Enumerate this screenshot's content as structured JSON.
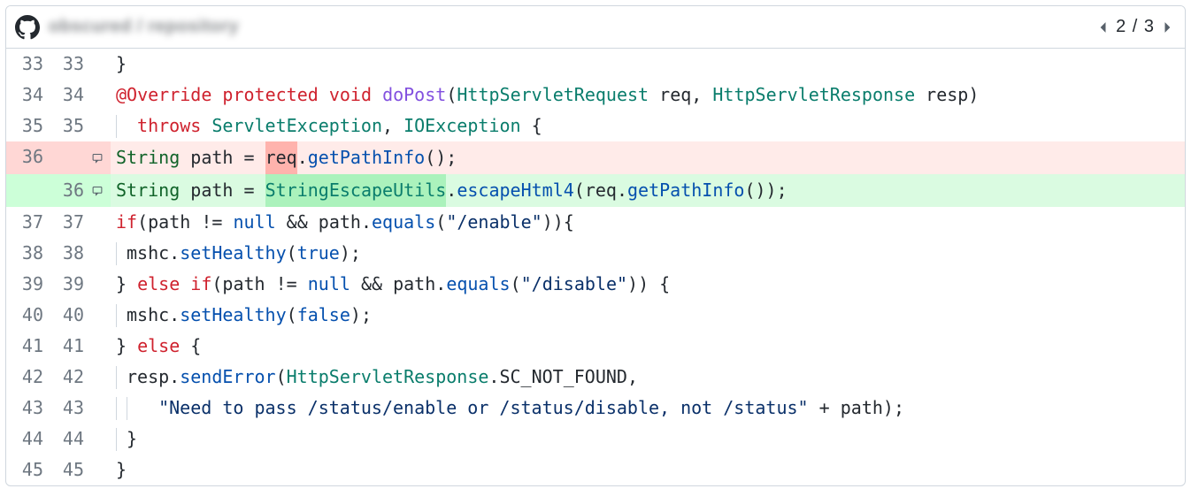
{
  "header": {
    "repo_name_obscured": "obscured / repository",
    "pager": {
      "position": "2 / 3"
    }
  },
  "lines": {
    "l33": {
      "old": "33",
      "new": "33",
      "tokens": [
        {
          "t": "}",
          "c": "c-plain"
        }
      ]
    },
    "l34": {
      "old": "34",
      "new": "34",
      "tokens": [
        {
          "t": "@Override",
          "c": "c-ann"
        },
        {
          "t": " ",
          "c": "c-plain"
        },
        {
          "t": "protected",
          "c": "c-key"
        },
        {
          "t": " ",
          "c": "c-plain"
        },
        {
          "t": "void",
          "c": "c-void"
        },
        {
          "t": " ",
          "c": "c-plain"
        },
        {
          "t": "doPost",
          "c": "c-func"
        },
        {
          "t": "(",
          "c": "c-plain"
        },
        {
          "t": "HttpServletRequest",
          "c": "c-type"
        },
        {
          "t": " req, ",
          "c": "c-plain"
        },
        {
          "t": "HttpServletResponse",
          "c": "c-type"
        },
        {
          "t": " resp)",
          "c": "c-plain"
        }
      ]
    },
    "l35": {
      "old": "35",
      "new": "35",
      "guides": 1,
      "tokens": [
        {
          "t": " throws ",
          "c": "c-key"
        },
        {
          "t": "ServletException",
          "c": "c-type"
        },
        {
          "t": ", ",
          "c": "c-plain"
        },
        {
          "t": "IOException",
          "c": "c-type"
        },
        {
          "t": " {",
          "c": "c-plain"
        }
      ]
    },
    "ldel": {
      "old": "36",
      "new": "",
      "comment": true,
      "tokens": [
        {
          "t": "String",
          "c": "c-type2"
        },
        {
          "t": " path = ",
          "c": "c-plain"
        },
        {
          "t": "req",
          "c": "c-plain",
          "hl": "del"
        },
        {
          "t": ".",
          "c": "c-plain"
        },
        {
          "t": "getPathInfo",
          "c": "c-call"
        },
        {
          "t": "();",
          "c": "c-plain"
        }
      ]
    },
    "ladd": {
      "old": "",
      "new": "36",
      "comment": true,
      "tokens": [
        {
          "t": "String",
          "c": "c-type2"
        },
        {
          "t": " path = ",
          "c": "c-plain"
        },
        {
          "t": "StringEscapeUtils",
          "c": "c-type",
          "hl": "add"
        },
        {
          "t": ".",
          "c": "c-plain"
        },
        {
          "t": "escapeHtml4",
          "c": "c-call"
        },
        {
          "t": "(req.",
          "c": "c-plain"
        },
        {
          "t": "getPathInfo",
          "c": "c-call"
        },
        {
          "t": "());",
          "c": "c-plain"
        }
      ]
    },
    "l37": {
      "old": "37",
      "new": "37",
      "tokens": [
        {
          "t": "if",
          "c": "c-key"
        },
        {
          "t": "(path != ",
          "c": "c-plain"
        },
        {
          "t": "null",
          "c": "c-bool"
        },
        {
          "t": " && path.",
          "c": "c-plain"
        },
        {
          "t": "equals",
          "c": "c-call"
        },
        {
          "t": "(",
          "c": "c-plain"
        },
        {
          "t": "\"/enable\"",
          "c": "c-str"
        },
        {
          "t": ")){",
          "c": "c-plain"
        }
      ]
    },
    "l38": {
      "old": "38",
      "new": "38",
      "guides": 1,
      "tokens": [
        {
          "t": "mshc.",
          "c": "c-plain"
        },
        {
          "t": "setHealthy",
          "c": "c-call"
        },
        {
          "t": "(",
          "c": "c-plain"
        },
        {
          "t": "true",
          "c": "c-bool"
        },
        {
          "t": ");",
          "c": "c-plain"
        }
      ]
    },
    "l39": {
      "old": "39",
      "new": "39",
      "tokens": [
        {
          "t": "} ",
          "c": "c-plain"
        },
        {
          "t": "else if",
          "c": "c-key"
        },
        {
          "t": "(path != ",
          "c": "c-plain"
        },
        {
          "t": "null",
          "c": "c-bool"
        },
        {
          "t": " && path.",
          "c": "c-plain"
        },
        {
          "t": "equals",
          "c": "c-call"
        },
        {
          "t": "(",
          "c": "c-plain"
        },
        {
          "t": "\"/disable\"",
          "c": "c-str"
        },
        {
          "t": ")) {",
          "c": "c-plain"
        }
      ]
    },
    "l40": {
      "old": "40",
      "new": "40",
      "guides": 1,
      "tokens": [
        {
          "t": "mshc.",
          "c": "c-plain"
        },
        {
          "t": "setHealthy",
          "c": "c-call"
        },
        {
          "t": "(",
          "c": "c-plain"
        },
        {
          "t": "false",
          "c": "c-bool"
        },
        {
          "t": ");",
          "c": "c-plain"
        }
      ]
    },
    "l41": {
      "old": "41",
      "new": "41",
      "tokens": [
        {
          "t": "} ",
          "c": "c-plain"
        },
        {
          "t": "else",
          "c": "c-key"
        },
        {
          "t": " {",
          "c": "c-plain"
        }
      ]
    },
    "l42": {
      "old": "42",
      "new": "42",
      "guides": 1,
      "tokens": [
        {
          "t": "resp.",
          "c": "c-plain"
        },
        {
          "t": "sendError",
          "c": "c-call"
        },
        {
          "t": "(",
          "c": "c-plain"
        },
        {
          "t": "HttpServletResponse",
          "c": "c-type"
        },
        {
          "t": ".SC_NOT_FOUND,",
          "c": "c-plain"
        }
      ]
    },
    "l43": {
      "old": "43",
      "new": "43",
      "guides": 2,
      "tokens": [
        {
          "t": "  ",
          "c": "c-plain"
        },
        {
          "t": "\"Need to pass /status/enable or /status/disable, not /status\"",
          "c": "c-str"
        },
        {
          "t": " + path);",
          "c": "c-plain"
        }
      ]
    },
    "l44": {
      "old": "44",
      "new": "44",
      "guides": 1,
      "tokens": [
        {
          "t": "}",
          "c": "c-plain"
        }
      ]
    },
    "l45": {
      "old": "45",
      "new": "45",
      "tokens": [
        {
          "t": "}",
          "c": "c-plain"
        }
      ]
    }
  },
  "order": [
    "l33",
    "l34",
    "l35",
    "ldel",
    "ladd",
    "l37",
    "l38",
    "l39",
    "l40",
    "l41",
    "l42",
    "l43",
    "l44",
    "l45"
  ]
}
